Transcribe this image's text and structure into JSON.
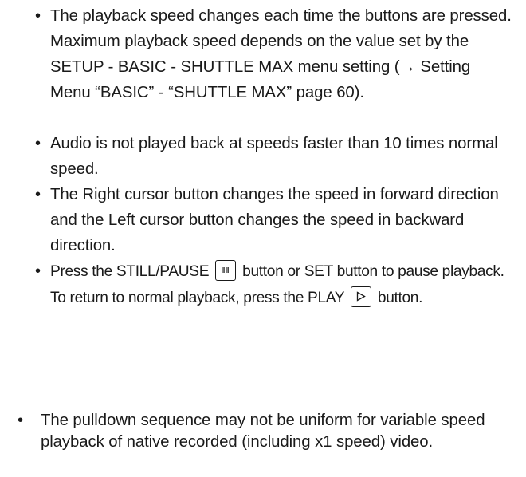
{
  "sub_bullets": [
    {
      "text": "The playback speed changes each time the buttons are pressed. Maximum playback speed depends on the value set by the SETUP - BASIC - SHUTTLE MAX menu setting (→ Setting Menu “BASIC” - “SHUTTLE MAX” page 60)."
    },
    {
      "text": "Audio is not played back at speeds faster than 10 times normal speed."
    },
    {
      "text": "The Right cursor button changes the speed in forward direction and the Left cursor button changes the speed in backward direction."
    },
    {
      "text_before_pause": "Press the STILL/PAUSE",
      "text_after_pause": "button or SET button to pause playback. To return to normal playback, press the PLAY",
      "text_after_play": "button.",
      "pause_icon": "pause-button-icon",
      "play_icon": "play-button-icon"
    }
  ],
  "main_bullet": {
    "text": "The pulldown sequence may not be uniform for variable speed playback of native recorded (including x1 speed) video."
  },
  "colors": {
    "text": "#1a1a1a",
    "background": "#ffffff"
  }
}
